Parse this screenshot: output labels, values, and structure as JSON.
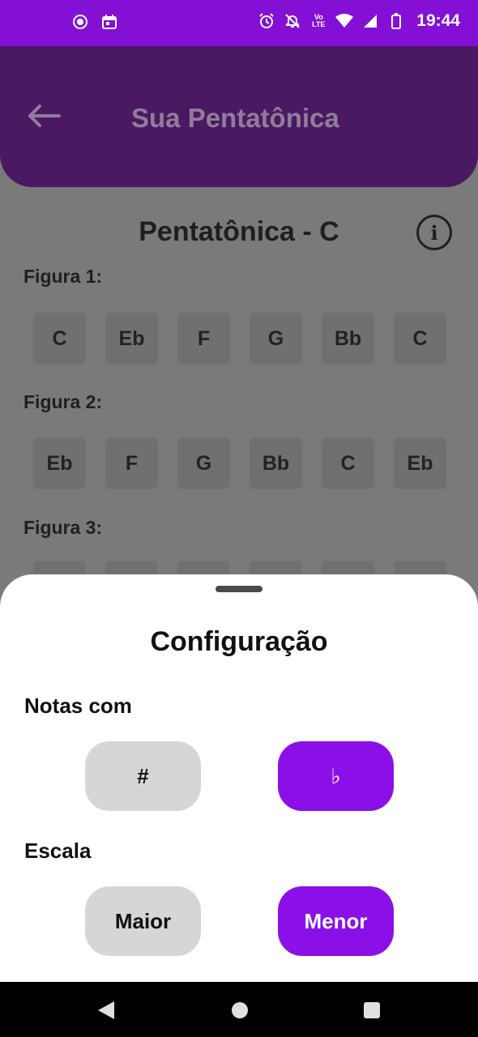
{
  "status_bar": {
    "time": "19:44",
    "left_icons": [
      "screen-record-icon",
      "calendar-icon"
    ],
    "right_icons": [
      "alarm-icon",
      "notifications-off-icon",
      "volte-icon",
      "wifi-icon",
      "signal-icon",
      "battery-icon"
    ],
    "volte_label": "Vo\nLTE"
  },
  "app_bar": {
    "title": "Sua Pentatônica",
    "back_icon": "arrow-left-icon"
  },
  "content": {
    "scale_title": "Pentatônica - C",
    "info_icon": "info-icon",
    "info_glyph": "i",
    "figures": [
      {
        "label": "Figura 1:",
        "notes": [
          "C",
          "Eb",
          "F",
          "G",
          "Bb",
          "C"
        ]
      },
      {
        "label": "Figura 2:",
        "notes": [
          "Eb",
          "F",
          "G",
          "Bb",
          "C",
          "Eb"
        ]
      },
      {
        "label": "Figura 3:",
        "notes": [
          "",
          "",
          "",
          "",
          "",
          ""
        ]
      }
    ]
  },
  "sheet": {
    "title": "Configuração",
    "notes_section": {
      "label": "Notas com",
      "options": [
        {
          "label": "#",
          "selected": false
        },
        {
          "label": "♭",
          "selected": true
        }
      ]
    },
    "scale_section": {
      "label": "Escala",
      "options": [
        {
          "label": "Maior",
          "selected": false
        },
        {
          "label": "Menor",
          "selected": true
        }
      ]
    }
  },
  "nav_bar": {
    "buttons": [
      "back-triangle-icon",
      "home-circle-icon",
      "recents-square-icon"
    ]
  },
  "colors": {
    "status_bar": "#8410d6",
    "app_bar": "#4b1863",
    "accent": "#8b10e8",
    "unselected": "#d6d6d6",
    "scrim": "#7a7a7a"
  }
}
